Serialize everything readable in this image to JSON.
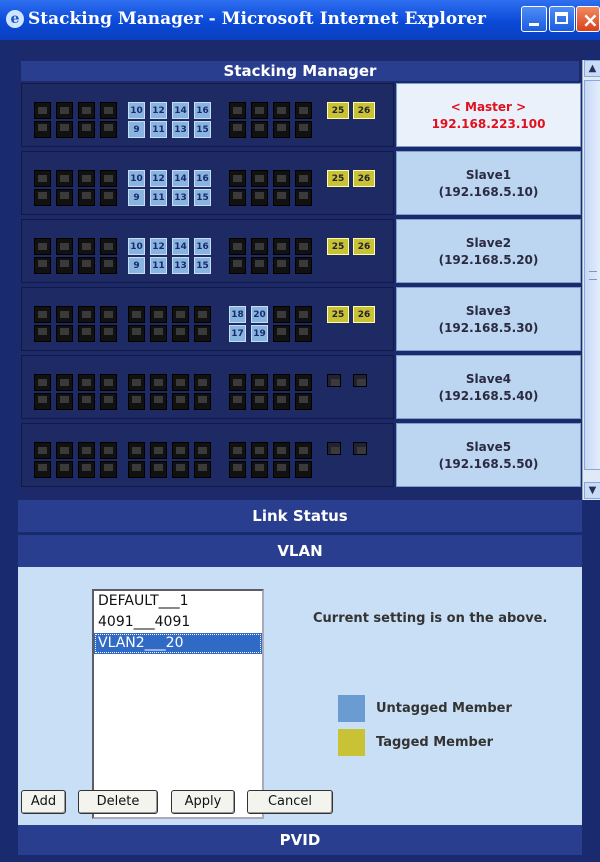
{
  "window": {
    "title": "Stacking Manager - Microsoft Internet Explorer"
  },
  "stacking": {
    "header": "Stacking Manager"
  },
  "units": [
    {
      "role": "< Master >",
      "ip": "192.168.223.100",
      "ports_blue_top": [
        "10",
        "12",
        "14",
        "16"
      ],
      "ports_blue_bottom": [
        "9",
        "11",
        "13",
        "15"
      ],
      "ports_yellow": [
        "25",
        "26"
      ]
    },
    {
      "role": "Slave1",
      "ip": "(192.168.5.10)",
      "ports_blue_top": [
        "10",
        "12",
        "14",
        "16"
      ],
      "ports_blue_bottom": [
        "9",
        "11",
        "13",
        "15"
      ],
      "ports_yellow": [
        "25",
        "26"
      ]
    },
    {
      "role": "Slave2",
      "ip": "(192.168.5.20)",
      "ports_blue_top": [
        "10",
        "12",
        "14",
        "16"
      ],
      "ports_blue_bottom": [
        "9",
        "11",
        "13",
        "15"
      ],
      "ports_yellow": [
        "25",
        "26"
      ]
    },
    {
      "role": "Slave3",
      "ip": "(192.168.5.30)",
      "ports_blue_top": [
        "18",
        "20"
      ],
      "ports_blue_bottom": [
        "17",
        "19"
      ],
      "ports_yellow": [
        "25",
        "26"
      ]
    },
    {
      "role": "Slave4",
      "ip": "(192.168.5.40)"
    },
    {
      "role": "Slave5",
      "ip": "(192.168.5.50)"
    }
  ],
  "sections": {
    "link_status": "Link Status",
    "vlan": "VLAN",
    "pvid": "PVID"
  },
  "vlan_list": {
    "options": [
      "DEFAULT___1",
      "4091___4091",
      "VLAN2___20"
    ],
    "selected_index": 2
  },
  "note": "Current setting is on the above.",
  "legend": {
    "untagged": "Untagged Member",
    "tagged": "Tagged Member",
    "untagged_color": "#6a9bd1",
    "tagged_color": "#c9c234"
  },
  "buttons": {
    "add": "Add",
    "delete": "Delete",
    "apply": "Apply",
    "cancel": "Cancel"
  }
}
